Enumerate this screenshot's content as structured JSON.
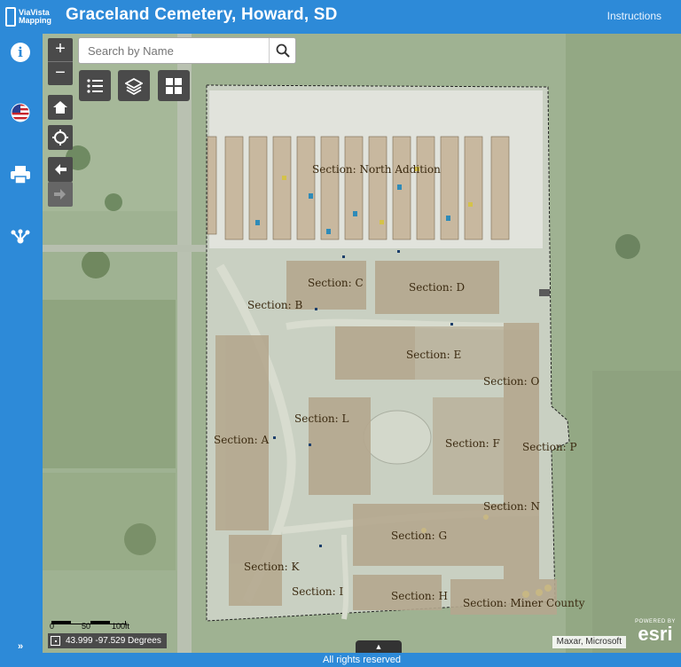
{
  "header": {
    "logo_line1": "ViaVista",
    "logo_line2": "Mapping",
    "title": "Graceland Cemetery, Howard, SD",
    "instructions_label": "Instructions"
  },
  "sidebar": {
    "items": [
      {
        "name": "info",
        "icon": "info-icon"
      },
      {
        "name": "flag",
        "icon": "us-flag-icon"
      },
      {
        "name": "print",
        "icon": "printer-icon"
      },
      {
        "name": "share",
        "icon": "share-icon"
      }
    ],
    "expand_label": "»"
  },
  "map": {
    "zoom_in": "+",
    "zoom_out": "−",
    "search": {
      "placeholder": "Search by Name"
    },
    "sections": [
      "Section:  North Addition",
      "Section:  B",
      "Section:  C",
      "Section:  D",
      "Section:  E",
      "Section:  O",
      "Section:  L",
      "Section:  A",
      "Section:  F",
      "Section:  P",
      "Section:  N",
      "Section:  G",
      "Section:  K",
      "Section:  I",
      "Section:  H",
      "Section:  Miner County"
    ],
    "scale": {
      "labels": [
        "0",
        "50",
        "100ft"
      ]
    },
    "coordinates": "43.999 -97.529 Degrees",
    "attribution": "Maxar, Microsoft",
    "esri": {
      "powered": "POWERED BY",
      "brand": "esri"
    }
  },
  "footer": {
    "text": "All rights reserved"
  },
  "colors": {
    "accent": "#2d8ad8",
    "control": "#4a4a4a"
  }
}
